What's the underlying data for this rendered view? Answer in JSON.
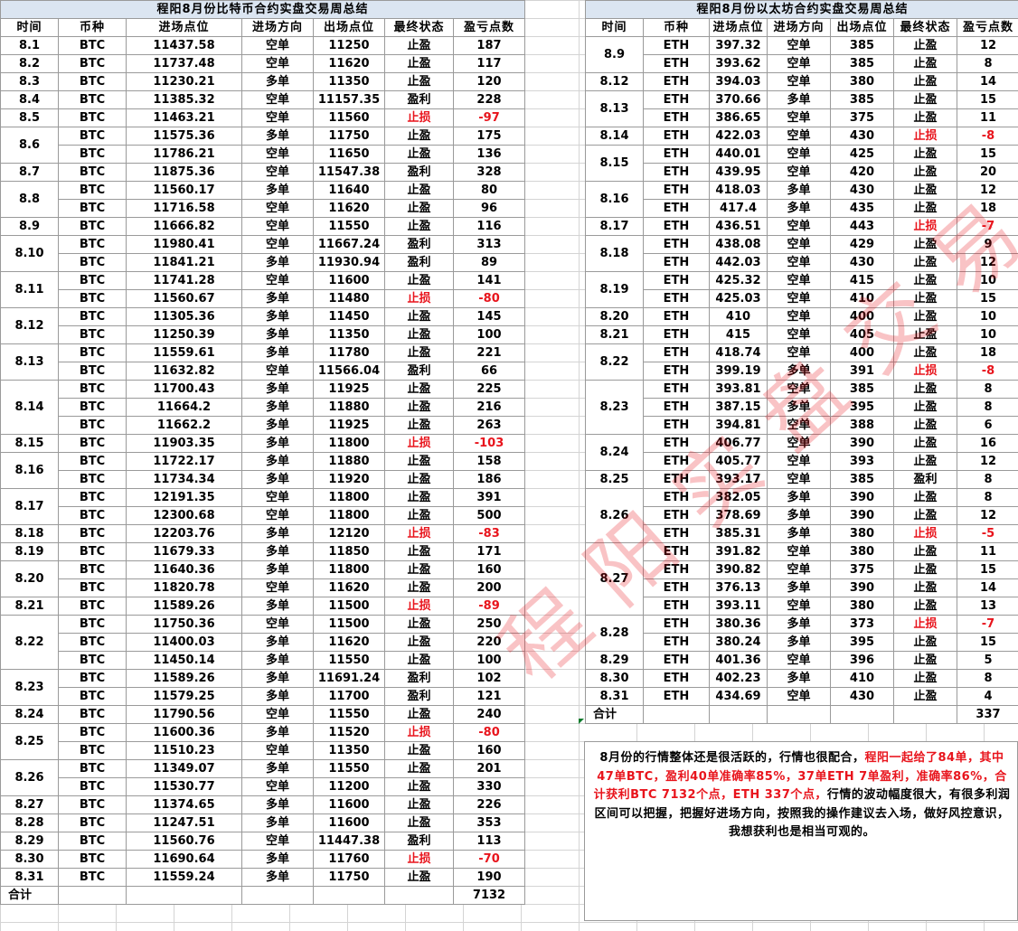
{
  "btc": {
    "title": "程阳8月份比特币合约实盘交易周总结",
    "headers": [
      "时间",
      "币种",
      "进场点位",
      "进场方向",
      "出场点位",
      "最终状态",
      "盈亏点数"
    ],
    "rows": [
      [
        "8.1",
        "BTC",
        "11437.58",
        "空单",
        "11250",
        "止盈",
        "187"
      ],
      [
        "8.2",
        "BTC",
        "11737.48",
        "空单",
        "11620",
        "止盈",
        "117"
      ],
      [
        "8.3",
        "BTC",
        "11230.21",
        "多单",
        "11350",
        "止盈",
        "120"
      ],
      [
        "8.4",
        "BTC",
        "11385.32",
        "空单",
        "11157.35",
        "盈利",
        "228"
      ],
      [
        "8.5",
        "BTC",
        "11463.21",
        "空单",
        "11560",
        "止损",
        "-97"
      ],
      [
        "8.6",
        "BTC",
        "11575.36",
        "多单",
        "11750",
        "止盈",
        "175"
      ],
      [
        "",
        "BTC",
        "11786.21",
        "空单",
        "11650",
        "止盈",
        "136"
      ],
      [
        "8.7",
        "BTC",
        "11875.36",
        "空单",
        "11547.38",
        "盈利",
        "328"
      ],
      [
        "8.8",
        "BTC",
        "11560.17",
        "多单",
        "11640",
        "止盈",
        "80"
      ],
      [
        "",
        "BTC",
        "11716.58",
        "空单",
        "11620",
        "止盈",
        "96"
      ],
      [
        "8.9",
        "BTC",
        "11666.82",
        "空单",
        "11550",
        "止盈",
        "116"
      ],
      [
        "8.10",
        "BTC",
        "11980.41",
        "空单",
        "11667.24",
        "盈利",
        "313"
      ],
      [
        "",
        "BTC",
        "11841.21",
        "多单",
        "11930.94",
        "盈利",
        "89"
      ],
      [
        "8.11",
        "BTC",
        "11741.28",
        "空单",
        "11600",
        "止盈",
        "141"
      ],
      [
        "",
        "BTC",
        "11560.67",
        "多单",
        "11480",
        "止损",
        "-80"
      ],
      [
        "8.12",
        "BTC",
        "11305.36",
        "多单",
        "11450",
        "止盈",
        "145"
      ],
      [
        "",
        "BTC",
        "11250.39",
        "多单",
        "11350",
        "止盈",
        "100"
      ],
      [
        "8.13",
        "BTC",
        "11559.61",
        "多单",
        "11780",
        "止盈",
        "221"
      ],
      [
        "",
        "BTC",
        "11632.82",
        "空单",
        "11566.04",
        "盈利",
        "66"
      ],
      [
        "8.14",
        "BTC",
        "11700.43",
        "多单",
        "11925",
        "止盈",
        "225"
      ],
      [
        "",
        "BTC",
        "11664.2",
        "多单",
        "11880",
        "止盈",
        "216"
      ],
      [
        "",
        "BTC",
        "11662.2",
        "多单",
        "11925",
        "止盈",
        "263"
      ],
      [
        "8.15",
        "BTC",
        "11903.35",
        "多单",
        "11800",
        "止损",
        "-103"
      ],
      [
        "8.16",
        "BTC",
        "11722.17",
        "多单",
        "11880",
        "止盈",
        "158"
      ],
      [
        "",
        "BTC",
        "11734.34",
        "多单",
        "11920",
        "止盈",
        "186"
      ],
      [
        "8.17",
        "BTC",
        "12191.35",
        "空单",
        "11800",
        "止盈",
        "391"
      ],
      [
        "",
        "BTC",
        "12300.68",
        "空单",
        "11800",
        "止盈",
        "500"
      ],
      [
        "8.18",
        "BTC",
        "12203.76",
        "多单",
        "12120",
        "止损",
        "-83"
      ],
      [
        "8.19",
        "BTC",
        "11679.33",
        "多单",
        "11850",
        "止盈",
        "171"
      ],
      [
        "8.20",
        "BTC",
        "11640.36",
        "多单",
        "11800",
        "止盈",
        "160"
      ],
      [
        "",
        "BTC",
        "11820.78",
        "空单",
        "11620",
        "止盈",
        "200"
      ],
      [
        "8.21",
        "BTC",
        "11589.26",
        "多单",
        "11500",
        "止损",
        "-89"
      ],
      [
        "8.22",
        "BTC",
        "11750.36",
        "空单",
        "11500",
        "止盈",
        "250"
      ],
      [
        "",
        "BTC",
        "11400.03",
        "多单",
        "11620",
        "止盈",
        "220"
      ],
      [
        "",
        "BTC",
        "11450.14",
        "多单",
        "11550",
        "止盈",
        "100"
      ],
      [
        "8.23",
        "BTC",
        "11589.26",
        "多单",
        "11691.24",
        "盈利",
        "102"
      ],
      [
        "",
        "BTC",
        "11579.25",
        "多单",
        "11700",
        "盈利",
        "121"
      ],
      [
        "8.24",
        "BTC",
        "11790.56",
        "空单",
        "11550",
        "止盈",
        "240"
      ],
      [
        "8.25",
        "BTC",
        "11600.36",
        "多单",
        "11520",
        "止损",
        "-80"
      ],
      [
        "",
        "BTC",
        "11510.23",
        "空单",
        "11350",
        "止盈",
        "160"
      ],
      [
        "8.26",
        "BTC",
        "11349.07",
        "多单",
        "11550",
        "止盈",
        "201"
      ],
      [
        "",
        "BTC",
        "11530.77",
        "空单",
        "11200",
        "止盈",
        "330"
      ],
      [
        "8.27",
        "BTC",
        "11374.65",
        "多单",
        "11600",
        "止盈",
        "226"
      ],
      [
        "8.28",
        "BTC",
        "11247.51",
        "多单",
        "11600",
        "止盈",
        "353"
      ],
      [
        "8.29",
        "BTC",
        "11560.76",
        "空单",
        "11447.38",
        "盈利",
        "113"
      ],
      [
        "8.30",
        "BTC",
        "11690.64",
        "多单",
        "11760",
        "止损",
        "-70"
      ],
      [
        "8.31",
        "BTC",
        "11559.24",
        "多单",
        "11750",
        "止盈",
        "190"
      ]
    ],
    "total_label": "合计",
    "total": "7132"
  },
  "eth": {
    "title": "程阳8月份以太坊合约实盘交易周总结",
    "headers": [
      "时间",
      "币种",
      "进场点位",
      "进场方向",
      "出场点位",
      "最终状态",
      "盈亏点数"
    ],
    "rows": [
      [
        "8.9",
        "ETH",
        "397.32",
        "空单",
        "385",
        "止盈",
        "12"
      ],
      [
        "",
        "ETH",
        "393.62",
        "空单",
        "385",
        "止盈",
        "8"
      ],
      [
        "8.12",
        "ETH",
        "394.03",
        "空单",
        "380",
        "止盈",
        "14"
      ],
      [
        "8.13",
        "ETH",
        "370.66",
        "多单",
        "385",
        "止盈",
        "15"
      ],
      [
        "",
        "ETH",
        "386.65",
        "空单",
        "375",
        "止盈",
        "11"
      ],
      [
        "8.14",
        "ETH",
        "422.03",
        "空单",
        "430",
        "止损",
        "-8"
      ],
      [
        "8.15",
        "ETH",
        "440.01",
        "空单",
        "425",
        "止盈",
        "15"
      ],
      [
        "",
        "ETH",
        "439.95",
        "空单",
        "420",
        "止盈",
        "20"
      ],
      [
        "8.16",
        "ETH",
        "418.03",
        "多单",
        "430",
        "止盈",
        "12"
      ],
      [
        "",
        "ETH",
        "417.4",
        "多单",
        "435",
        "止盈",
        "18"
      ],
      [
        "8.17",
        "ETH",
        "436.51",
        "空单",
        "443",
        "止损",
        "-7"
      ],
      [
        "8.18",
        "ETH",
        "438.08",
        "空单",
        "429",
        "止盈",
        "9"
      ],
      [
        "",
        "ETH",
        "442.03",
        "空单",
        "430",
        "止盈",
        "12"
      ],
      [
        "8.19",
        "ETH",
        "425.32",
        "空单",
        "415",
        "止盈",
        "10"
      ],
      [
        "",
        "ETH",
        "425.03",
        "空单",
        "410",
        "止盈",
        "15"
      ],
      [
        "8.20",
        "ETH",
        "410",
        "空单",
        "400",
        "止盈",
        "10"
      ],
      [
        "8.21",
        "ETH",
        "415",
        "空单",
        "405",
        "止盈",
        "10"
      ],
      [
        "8.22",
        "ETH",
        "418.74",
        "空单",
        "400",
        "止盈",
        "18"
      ],
      [
        "",
        "ETH",
        "399.19",
        "多单",
        "391",
        "止损",
        "-8"
      ],
      [
        "8.23",
        "ETH",
        "393.81",
        "空单",
        "385",
        "止盈",
        "8"
      ],
      [
        "",
        "ETH",
        "387.15",
        "多单",
        "395",
        "止盈",
        "8"
      ],
      [
        "",
        "ETH",
        "394.81",
        "空单",
        "388",
        "止盈",
        "6"
      ],
      [
        "8.24",
        "ETH",
        "406.77",
        "空单",
        "390",
        "止盈",
        "16"
      ],
      [
        "",
        "ETH",
        "405.77",
        "空单",
        "393",
        "止盈",
        "12"
      ],
      [
        "8.25",
        "ETH",
        "393.17",
        "空单",
        "385",
        "盈利",
        "8"
      ],
      [
        "8.26",
        "ETH",
        "382.05",
        "多单",
        "390",
        "止盈",
        "8"
      ],
      [
        "",
        "ETH",
        "378.69",
        "多单",
        "390",
        "止盈",
        "12"
      ],
      [
        "",
        "ETH",
        "385.31",
        "多单",
        "380",
        "止损",
        "-5"
      ],
      [
        "8.27",
        "ETH",
        "391.82",
        "空单",
        "380",
        "止盈",
        "11"
      ],
      [
        "",
        "ETH",
        "390.82",
        "空单",
        "375",
        "止盈",
        "15"
      ],
      [
        "",
        "ETH",
        "376.13",
        "多单",
        "390",
        "止盈",
        "14"
      ],
      [
        "",
        "ETH",
        "393.11",
        "空单",
        "380",
        "止盈",
        "13"
      ],
      [
        "8.28",
        "ETH",
        "380.36",
        "多单",
        "373",
        "止损",
        "-7"
      ],
      [
        "",
        "ETH",
        "380.24",
        "多单",
        "395",
        "止盈",
        "15"
      ],
      [
        "8.29",
        "ETH",
        "401.36",
        "空单",
        "396",
        "止盈",
        "5"
      ],
      [
        "8.30",
        "ETH",
        "402.23",
        "多单",
        "410",
        "止盈",
        "8"
      ],
      [
        "8.31",
        "ETH",
        "434.69",
        "空单",
        "430",
        "止盈",
        "4"
      ]
    ],
    "total_label": "合计",
    "total": "337"
  },
  "summary": {
    "p1": "8月份的行情整体还是很活跃的，行情也很配合，",
    "p2": "程阳一起给了84单，其中47单BTC，盈利40单准确率85%，37单ETH 7单盈利，准确率86%，合计获利BTC 7132个点，ETH 337个点，",
    "p3": "行情的波动幅度很大，有很多利润区间可以把握，把握好进场方向，按照我的操作建议去入场，做好风控意识，我想获利也是相当可观的。"
  },
  "watermark": "程阳实盘交易月总结",
  "colors": {
    "loss": "#e8141c",
    "title_bg": "#dbe5f1"
  }
}
